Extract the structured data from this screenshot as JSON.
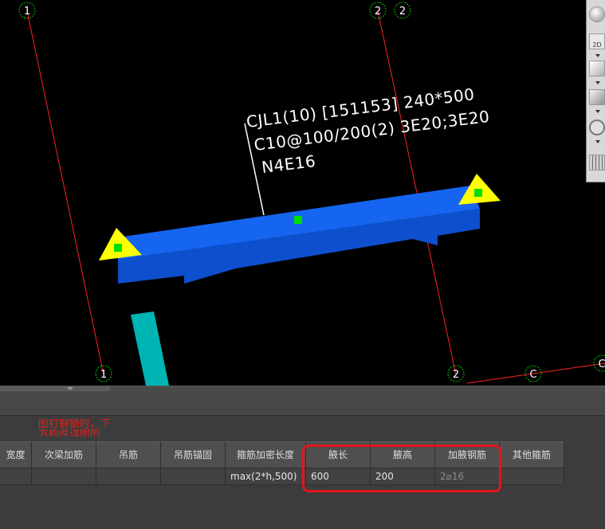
{
  "viewport": {
    "axis_markers": {
      "top_left": "1",
      "top_mid_a": "2",
      "top_mid_b": "2",
      "bottom_left": "1",
      "bottom_mid": "2",
      "bottom_right": "C",
      "bottom_far_right": "C"
    },
    "beam_annotation": {
      "line1": "CJL1(10) [151153] 240*500",
      "line2": "C10@100/200(2) 3E20;3E20",
      "line3": "N4E16"
    },
    "colors": {
      "beam_top": "#1565f0",
      "beam_side": "#0d4fcc",
      "column": "#00b4b4",
      "support": "#ffff00",
      "grip": "#00e000",
      "axis_line": "#ff2020",
      "marker_circle": "#00cc00"
    }
  },
  "right_toolbar": {
    "icons": [
      "sphere-icon",
      "2d-view-icon",
      "box-view-icon",
      "solid-box-icon",
      "rotate-icon",
      "grid-view-icon"
    ],
    "view_2d_label": "2D"
  },
  "panel": {
    "hint_text": "图钉解锁时，下\n方构件详图的",
    "columns": [
      "宽度",
      "次梁加筋",
      "吊筋",
      "吊筋锚固",
      "箍筋加密长度",
      "腋长",
      "腋高",
      "加腋钢筋",
      "其他箍筋"
    ],
    "row": [
      "",
      "",
      "",
      "",
      "max(2*h,500)",
      "600",
      "200",
      "2⌀16",
      ""
    ]
  }
}
